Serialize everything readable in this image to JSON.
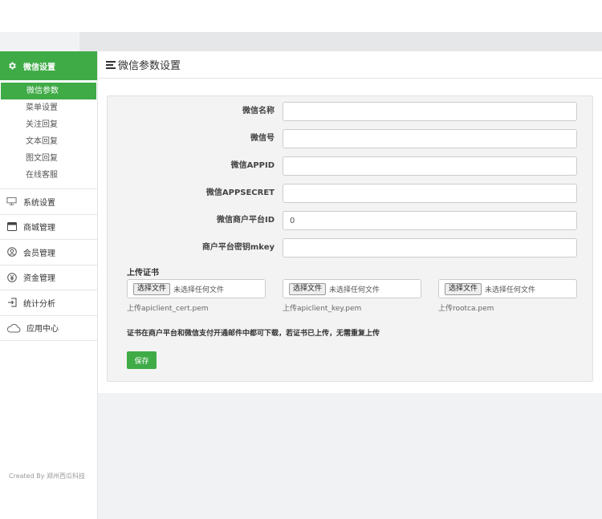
{
  "sidebar": {
    "active_section": "微信设置",
    "sub_items": [
      "微信参数",
      "菜单设置",
      "关注回复",
      "文本回复",
      "图文回复",
      "在线客服"
    ],
    "groups": [
      {
        "label": "系统设置",
        "icon": "monitor-icon"
      },
      {
        "label": "商城管理",
        "icon": "card-icon"
      },
      {
        "label": "会员管理",
        "icon": "user-circle-icon"
      },
      {
        "label": "资金管理",
        "icon": "yen-circle-icon"
      },
      {
        "label": "统计分析",
        "icon": "sign-in-icon"
      },
      {
        "label": "应用中心",
        "icon": "cloud-icon"
      }
    ],
    "credit": "Created By 郑州西瓜科技"
  },
  "header": {
    "title": "微信参数设置"
  },
  "form": {
    "fields": [
      {
        "label": "微信名称",
        "value": ""
      },
      {
        "label": "微信号",
        "value": ""
      },
      {
        "label": "微信APPID",
        "value": ""
      },
      {
        "label": "微信APPSECRET",
        "value": ""
      },
      {
        "label": "微信商户平台ID",
        "value": "0"
      },
      {
        "label": "商户平台密钥mkey",
        "value": ""
      }
    ],
    "cert_title": "上传证书",
    "certs": [
      {
        "button": "选择文件",
        "status": "未选择任何文件",
        "hint": "上传apiclient_cert.pem"
      },
      {
        "button": "选择文件",
        "status": "未选择任何文件",
        "hint": "上传apiclient_key.pem"
      },
      {
        "button": "选择文件",
        "status": "未选择任何文件",
        "hint": "上传rootca.pem"
      }
    ],
    "notice": "证书在商户平台和微信支付开通邮件中都可下载，若证书已上传，无需重复上传",
    "save_label": "保存"
  },
  "colors": {
    "accent": "#3fab47"
  }
}
